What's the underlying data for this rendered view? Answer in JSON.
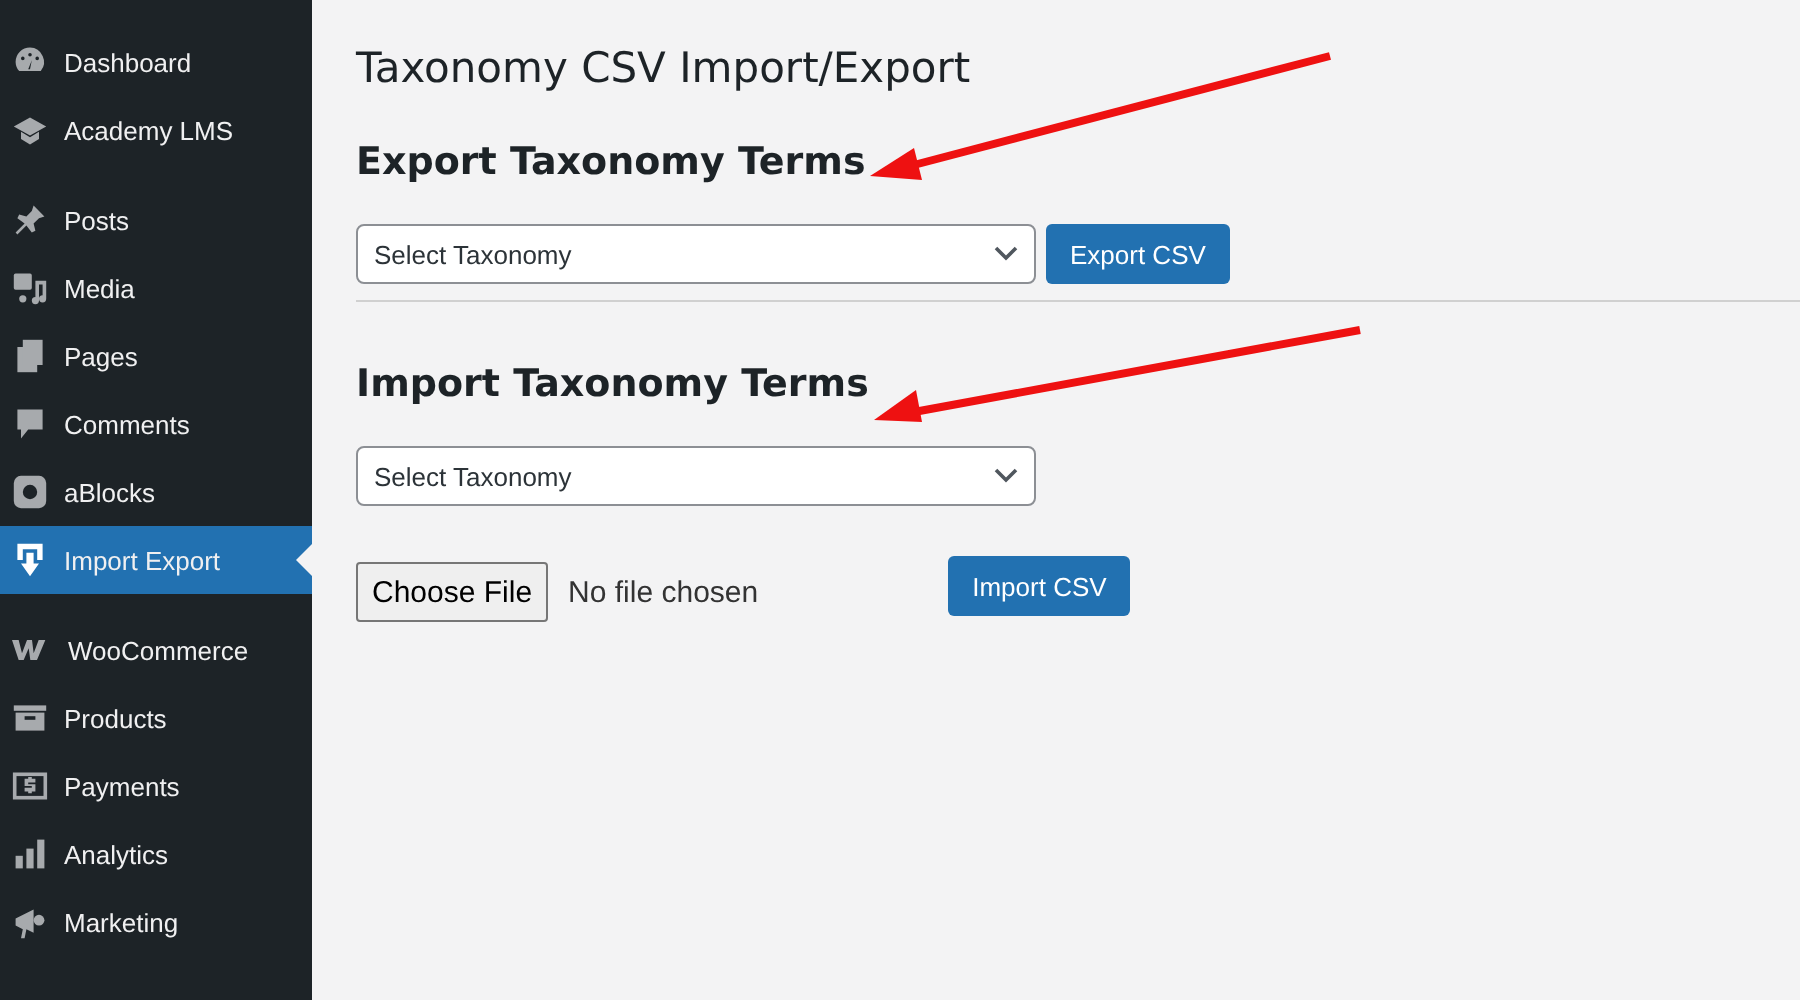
{
  "sidebar": {
    "groups": [
      [
        {
          "label": "Dashboard",
          "selected": false
        },
        {
          "label": "Academy LMS",
          "selected": false
        }
      ],
      [
        {
          "label": "Posts",
          "selected": false
        },
        {
          "label": "Media",
          "selected": false
        },
        {
          "label": "Pages",
          "selected": false
        },
        {
          "label": "Comments",
          "selected": false
        },
        {
          "label": "aBlocks",
          "selected": false
        },
        {
          "label": "Import Export",
          "selected": true
        }
      ],
      [
        {
          "label": "WooCommerce",
          "selected": false
        },
        {
          "label": "Products",
          "selected": false
        },
        {
          "label": "Payments",
          "selected": false
        },
        {
          "label": "Analytics",
          "selected": false
        },
        {
          "label": "Marketing",
          "selected": false
        }
      ]
    ]
  },
  "page_title": "Taxonomy CSV Import/Export",
  "export": {
    "heading": "Export Taxonomy Terms",
    "select": "Select Taxonomy",
    "button": "Export CSV"
  },
  "import": {
    "heading": "Import Taxonomy Terms",
    "select": "Select Taxonomy",
    "file_button": "Choose File",
    "file_status": "No file chosen",
    "button": "Import CSV"
  }
}
